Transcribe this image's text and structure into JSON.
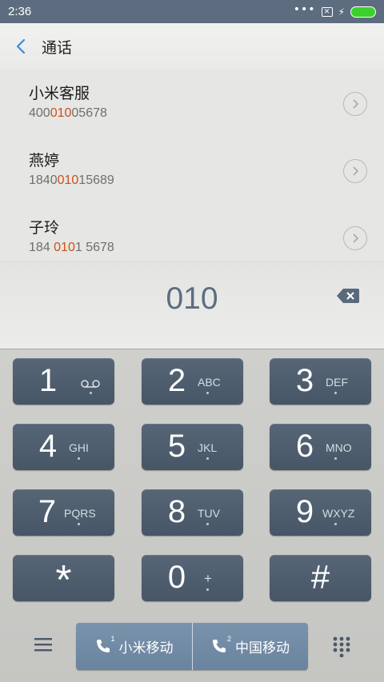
{
  "status_bar": {
    "time": "2:36",
    "dots": "•••"
  },
  "header": {
    "title": "通话"
  },
  "contacts": [
    {
      "name": "小米客服",
      "number_pre": "400",
      "number_hl": "010",
      "number_post": "05678"
    },
    {
      "name": "燕婷",
      "number_pre": "1840",
      "number_hl": "010",
      "number_post": "15689"
    },
    {
      "name": "子玲",
      "number_pre": "184 ",
      "number_hl": "010",
      "number_post": "1 5678"
    }
  ],
  "dial": {
    "value": "010"
  },
  "keypad": [
    {
      "digit": "1",
      "letters": ""
    },
    {
      "digit": "2",
      "letters": "ABC"
    },
    {
      "digit": "3",
      "letters": "DEF"
    },
    {
      "digit": "4",
      "letters": "GHI"
    },
    {
      "digit": "5",
      "letters": "JKL"
    },
    {
      "digit": "6",
      "letters": "MNO"
    },
    {
      "digit": "7",
      "letters": "PQRS"
    },
    {
      "digit": "8",
      "letters": "TUV"
    },
    {
      "digit": "9",
      "letters": "WXYZ"
    },
    {
      "digit": "*",
      "letters": ""
    },
    {
      "digit": "0",
      "letters": "+"
    },
    {
      "digit": "#",
      "letters": ""
    }
  ],
  "sim_buttons": [
    {
      "label": "小米移动",
      "sim_number": "1"
    },
    {
      "label": "中国移动",
      "sim_number": "2"
    }
  ],
  "colors": {
    "status_bar": "#5d6d7f",
    "key": "#4f5f70",
    "highlight": "#c9501c",
    "sim_button": "#7289a3",
    "battery": "#3bd12b"
  },
  "icons": [
    "back-icon",
    "chevron-right-icon",
    "voicemail-icon",
    "backspace-icon",
    "menu-icon",
    "dialpad-grid-icon",
    "phone-icon"
  ]
}
